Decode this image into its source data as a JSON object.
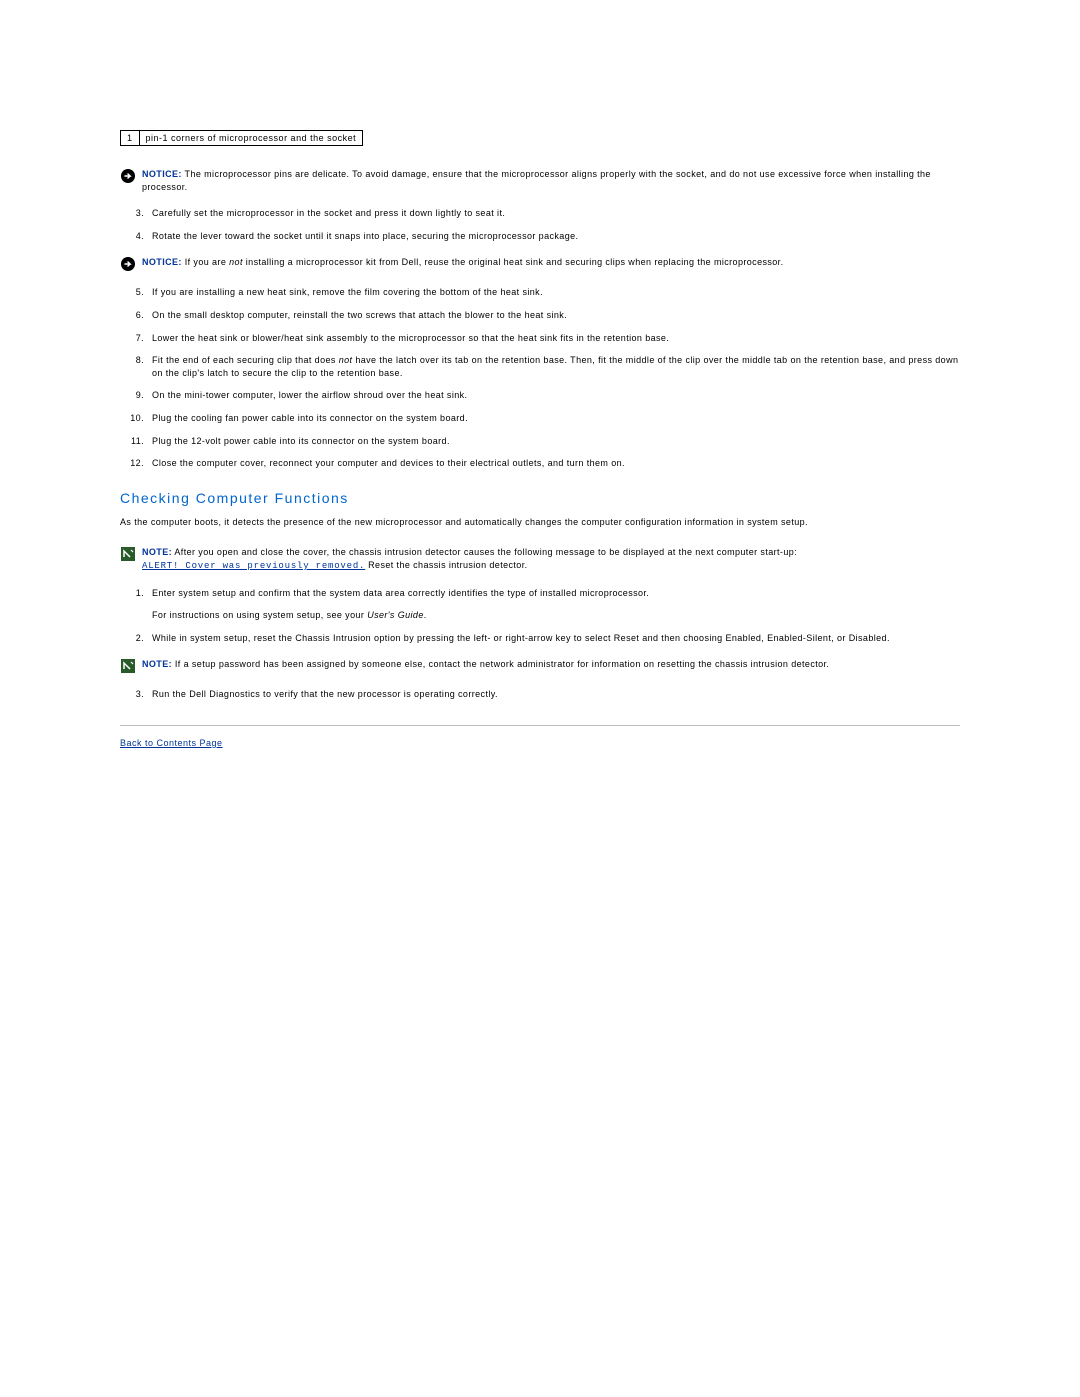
{
  "callout": {
    "num": "1",
    "text": "pin-1 corners of microprocessor and the socket"
  },
  "notice1": {
    "label": "NOTICE:",
    "text": " The microprocessor pins are delicate. To avoid damage, ensure that the microprocessor aligns properly with the socket, and do not use excessive force when installing the processor."
  },
  "steps_a": [
    {
      "n": "3.",
      "t": "Carefully set the microprocessor in the socket and press it down lightly to seat it."
    },
    {
      "n": "4.",
      "t": "Rotate the lever toward the socket until it snaps into place, securing the microprocessor package."
    }
  ],
  "notice2": {
    "label": "NOTICE:",
    "pre": " If you are ",
    "italic": "not",
    "post": " installing a microprocessor kit from Dell, reuse the original heat sink and securing clips when replacing the microprocessor."
  },
  "steps_b": [
    {
      "n": "5.",
      "t": "If you are installing a new heat sink, remove the film covering the bottom of the heat sink."
    },
    {
      "n": "6.",
      "t": "On the small desktop computer, reinstall the two screws that attach the blower to the heat sink."
    },
    {
      "n": "7.",
      "t": "Lower the heat sink or blower/heat sink assembly to the microprocessor so that the heat sink fits in the retention base."
    },
    {
      "n": "8.",
      "pre": "Fit the end of each securing clip that does ",
      "italic": "not",
      "post": " have the latch over its tab on the retention base. Then, fit the middle of the clip over the middle tab on the retention base, and press down on the clip's latch to secure the clip to the retention base."
    },
    {
      "n": "9.",
      "t": "On the mini-tower computer, lower the airflow shroud over the heat sink."
    },
    {
      "n": "10.",
      "t": "Plug the cooling fan power cable into its connector on the system board."
    },
    {
      "n": "11.",
      "t": "Plug the 12-volt power cable into its connector on the system board."
    },
    {
      "n": "12.",
      "t": "Close the computer cover, reconnect your computer and devices to their electrical outlets, and turn them on."
    }
  ],
  "section_title": "Checking Computer Functions",
  "body_para": "As the computer boots, it detects the presence of the new microprocessor and automatically changes the computer configuration information in system setup.",
  "note1": {
    "label": "NOTE:",
    "pre": " After you open and close the cover, the chassis intrusion detector causes the following message to be displayed at the next computer start-up: ",
    "alert": "ALERT! Cover was previously removed.",
    "post": " Reset the chassis intrusion detector."
  },
  "steps_c": [
    {
      "n": "1.",
      "t": "Enter system setup and confirm that the system data area correctly identifies the type of installed microprocessor."
    }
  ],
  "subtext1": {
    "pre": "For instructions on using system setup, see your ",
    "italic": "User's Guide",
    "post": "."
  },
  "steps_d": [
    {
      "n": "2.",
      "t": "While in system setup, reset the Chassis Intrusion option by pressing the left- or right-arrow key to select Reset and then choosing Enabled, Enabled-Silent, or Disabled."
    }
  ],
  "note2": {
    "label": "NOTE:",
    "text": " If a setup password has been assigned by someone else, contact the network administrator for information on resetting the chassis intrusion detector."
  },
  "steps_e": [
    {
      "n": "3.",
      "t": "Run the Dell Diagnostics to verify that the new processor is operating correctly."
    }
  ],
  "back_link": "Back to Contents Page"
}
